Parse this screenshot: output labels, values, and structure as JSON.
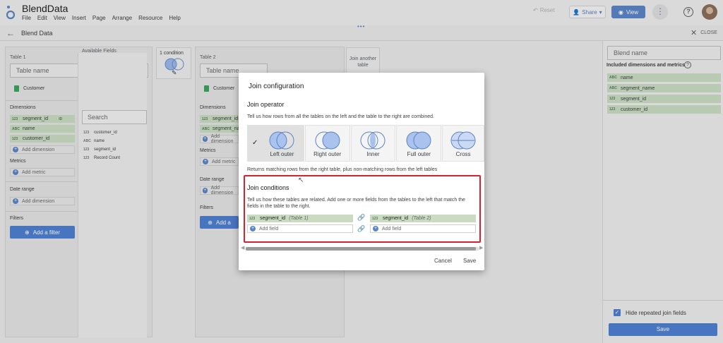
{
  "app": {
    "title": "BlendData",
    "menu": [
      "File",
      "Edit",
      "View",
      "Insert",
      "Page",
      "Arrange",
      "Resource",
      "Help"
    ],
    "reset_label": "Reset",
    "share_label": "Share",
    "view_label": "View"
  },
  "subheader": {
    "title": "Blend Data",
    "close_label": "CLOSE"
  },
  "table1": {
    "label": "Table 1",
    "name_placeholder": "Table name",
    "source": "Customer",
    "dimensions_title": "Dimensions",
    "dimensions": [
      {
        "type": "123",
        "name": "segment_id",
        "extra": "ID"
      },
      {
        "type": "ABC",
        "name": "name",
        "extra": ""
      },
      {
        "type": "123",
        "name": "customer_id",
        "extra": ""
      }
    ],
    "add_dimension": "Add dimension",
    "metrics_title": "Metrics",
    "add_metric": "Add metric",
    "date_range_title": "Date range",
    "add_date": "Add dimension",
    "filters_title": "Filters",
    "add_filter": "Add a filter",
    "available_title": "Available Fields",
    "search_placeholder": "Search",
    "available": [
      {
        "type": "123",
        "name": "customer_id"
      },
      {
        "type": "ABC",
        "name": "name"
      },
      {
        "type": "123",
        "name": "segment_id"
      },
      {
        "type": "123",
        "name": "Record Count"
      }
    ]
  },
  "join_chip": {
    "label": "1 condition"
  },
  "table2": {
    "label": "Table 2",
    "name_placeholder": "Table name",
    "source": "Customer",
    "dimensions_title": "Dimensions",
    "dimensions": [
      {
        "type": "123",
        "name": "segment_id"
      },
      {
        "type": "ABC",
        "name": "segment_name"
      }
    ],
    "add_dimension": "Add dimension",
    "metrics_title": "Metrics",
    "add_metric": "Add metric",
    "date_range_title": "Date range",
    "add_date": "Add dimension",
    "filters_title": "Filters",
    "add_filter": "Add a"
  },
  "join_another": {
    "label": "Join another table"
  },
  "right_panel": {
    "blend_name_placeholder": "Blend name",
    "included_title": "Included dimensions and metrics",
    "fields": [
      {
        "type": "ABC",
        "name": "name"
      },
      {
        "type": "ABC",
        "name": "segment_name"
      },
      {
        "type": "123",
        "name": "segment_id"
      },
      {
        "type": "123",
        "name": "customer_id"
      }
    ],
    "hide_repeated_label": "Hide repeated join fields",
    "save_label": "Save"
  },
  "modal": {
    "title": "Join configuration",
    "operator_title": "Join operator",
    "operator_desc": "Tell us how rows from all the tables on the left and the table to the right are combined.",
    "operators": [
      {
        "label": "Left outer",
        "selected": true
      },
      {
        "label": "Right outer",
        "selected": false
      },
      {
        "label": "Inner",
        "selected": false
      },
      {
        "label": "Full outer",
        "selected": false
      },
      {
        "label": "Cross",
        "selected": false
      }
    ],
    "operator_note": "Returns matching rows from the right table, plus non-matching rows from the left tables",
    "conditions_title": "Join conditions",
    "conditions_desc_1": "Tell us how these tables are related. Add one or more fields from the tables to the left that match the",
    "conditions_desc_2": "fields in the table to the right.",
    "left_field": {
      "type": "123",
      "name": "segment_id",
      "table": "(Table 1)"
    },
    "right_field": {
      "type": "123",
      "name": "segment_id",
      "table": "(Table 2)"
    },
    "add_field": "Add field",
    "cancel_label": "Cancel",
    "save_label": "Save"
  }
}
